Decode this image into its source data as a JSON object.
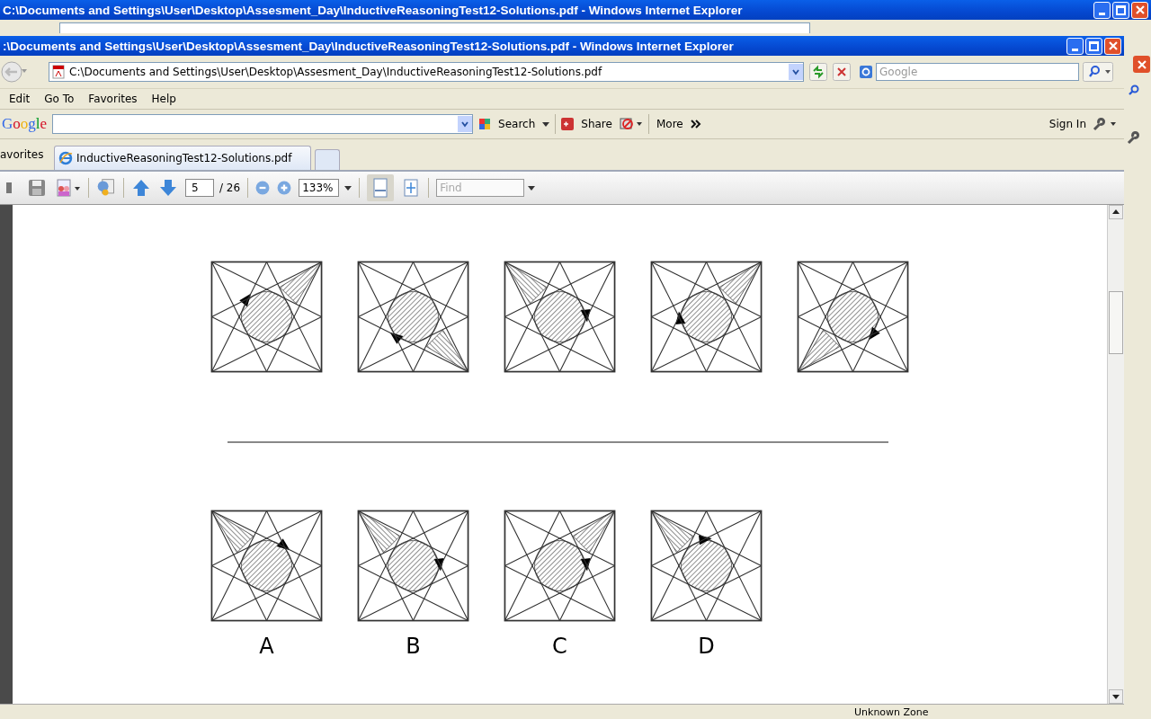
{
  "back_window": {
    "title": "C:\\Documents and Settings\\User\\Desktop\\Assesment_Day\\InductiveReasoningTest12-Solutions.pdf - Windows Internet Explorer"
  },
  "window": {
    "title": ":\\Documents and Settings\\User\\Desktop\\Assesment_Day\\InductiveReasoningTest12-Solutions.pdf - Windows Internet Explorer",
    "address": "C:\\Documents and Settings\\User\\Desktop\\Assesment_Day\\InductiveReasoningTest12-Solutions.pdf",
    "search_placeholder": "Google"
  },
  "menu": [
    "Edit",
    "Go To",
    "Favorites",
    "Help"
  ],
  "google_toolbar": {
    "logo": "Google",
    "search": "Search",
    "share": "Share",
    "more": "More",
    "sign_in": "Sign In"
  },
  "favorites": "avorites",
  "tabs": [
    {
      "label": "InductiveReasoningTest12-Solutions.pdf",
      "selected": true
    }
  ],
  "pdf_toolbar": {
    "page": "5",
    "page_count": "/ 26",
    "zoom": "133%",
    "find_placeholder": "Find"
  },
  "sequence": [
    {
      "kind": "ne_nw"
    },
    {
      "kind": "se_sw"
    },
    {
      "kind": "nw_e"
    },
    {
      "kind": "ne_w"
    },
    {
      "kind": "sw_se"
    }
  ],
  "answers": [
    {
      "label": "A",
      "kind": "nw_ne"
    },
    {
      "label": "B",
      "kind": "nw_e"
    },
    {
      "label": "C",
      "kind": "ne_e"
    },
    {
      "label": "D",
      "kind": "nw_n"
    }
  ],
  "status_bar": {
    "zone": "Unknown Zone"
  }
}
